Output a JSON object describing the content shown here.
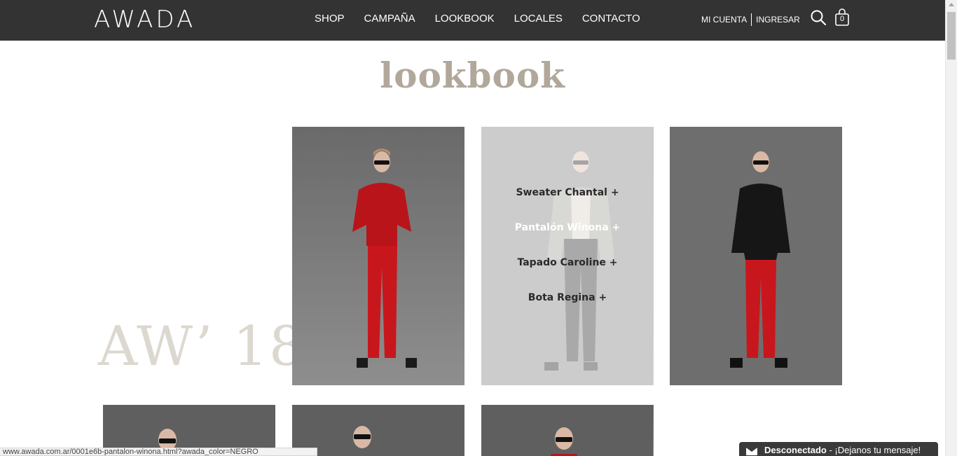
{
  "header": {
    "logo": "AWADA",
    "nav": [
      "SHOP",
      "CAMPAÑA",
      "LOOKBOOK",
      "LOCALES",
      "CONTACTO"
    ],
    "account": {
      "my_account": "MI CUENTA",
      "login": "INGRESAR"
    },
    "cart_count": "0"
  },
  "page": {
    "title": "lookbook",
    "season": "AW’ 18"
  },
  "looks": [
    {
      "outfit": "red-blouse-red-pants"
    },
    {
      "outfit": "tweed-cardigan-black-pants",
      "products": [
        "Sweater Chantal +",
        "Pantalón Winona +",
        "Tapado Caroline +",
        "Bota Regina +"
      ],
      "active_product": 1
    },
    {
      "outfit": "black-jacket-red-pants"
    }
  ],
  "status_bar": {
    "url": "www.awada.com.ar/0001e6b-pantalon-winona.html?awada_color=NEGRO"
  },
  "chat": {
    "status": "Desconectado",
    "message": " - ¡Dejanos tu mensaje!"
  },
  "colors": {
    "header_bg": "#333333",
    "title": "#b1a89b",
    "season": "#dcd8cf",
    "accent_red": "#c8161d"
  }
}
